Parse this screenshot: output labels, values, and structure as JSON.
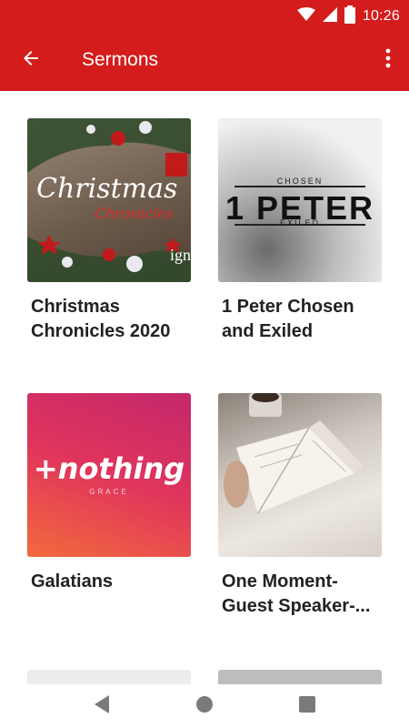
{
  "status_bar": {
    "time": "10:26",
    "icons": [
      "wifi-icon",
      "cell-signal-icon",
      "battery-icon"
    ]
  },
  "app_bar": {
    "title": "Sermons",
    "back_icon": "arrow-left-icon",
    "menu_icon": "more-vert-icon",
    "color": "#d41c1c"
  },
  "sermons": [
    {
      "title": "Christmas Chronicles 2020",
      "art_text": "Christmas",
      "art_subtext": "Chronicles",
      "art_brand": "ign"
    },
    {
      "title": "1 Peter Chosen and Exiled",
      "art_text": "1 PETER",
      "art_top": "CHOSEN",
      "art_bottom": "EXILED"
    },
    {
      "title": "Galatians",
      "art_text": "+nothing",
      "art_subtext": "GRACE"
    },
    {
      "title": "One Moment- Guest Speaker-...",
      "art_text": ""
    }
  ],
  "nav_bar": {
    "back": "nav-back-icon",
    "home": "nav-home-icon",
    "recents": "nav-recents-icon"
  }
}
